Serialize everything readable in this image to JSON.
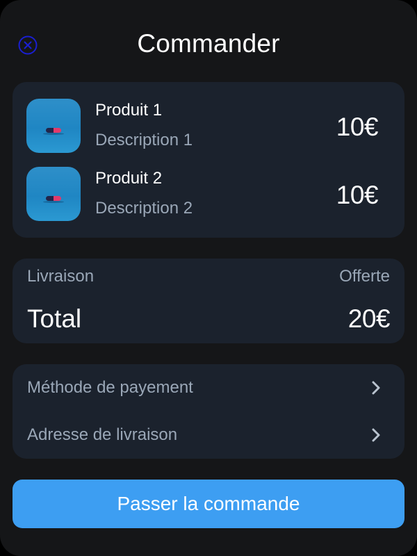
{
  "header": {
    "title": "Commander",
    "close_icon": "close-circle-icon",
    "close_color": "#1a1fd1"
  },
  "products": [
    {
      "name": "Produit 1",
      "description": "Description 1",
      "price": "10€",
      "image": "pill-capsule-on-blue"
    },
    {
      "name": "Produit 2",
      "description": "Description 2",
      "price": "10€",
      "image": "pill-capsule-on-blue"
    }
  ],
  "summary": {
    "shipping_label": "Livraison",
    "shipping_value": "Offerte",
    "total_label": "Total",
    "total_value": "20€"
  },
  "options": [
    {
      "label": "Méthode de payement",
      "icon": "chevron-right-icon"
    },
    {
      "label": "Adresse de livraison",
      "icon": "chevron-right-icon"
    }
  ],
  "action": {
    "label": "Passer la commande",
    "color": "#3d9ef2"
  },
  "colors": {
    "background": "#151618",
    "card": "#1b222d",
    "muted_text": "#9aa7b7"
  }
}
